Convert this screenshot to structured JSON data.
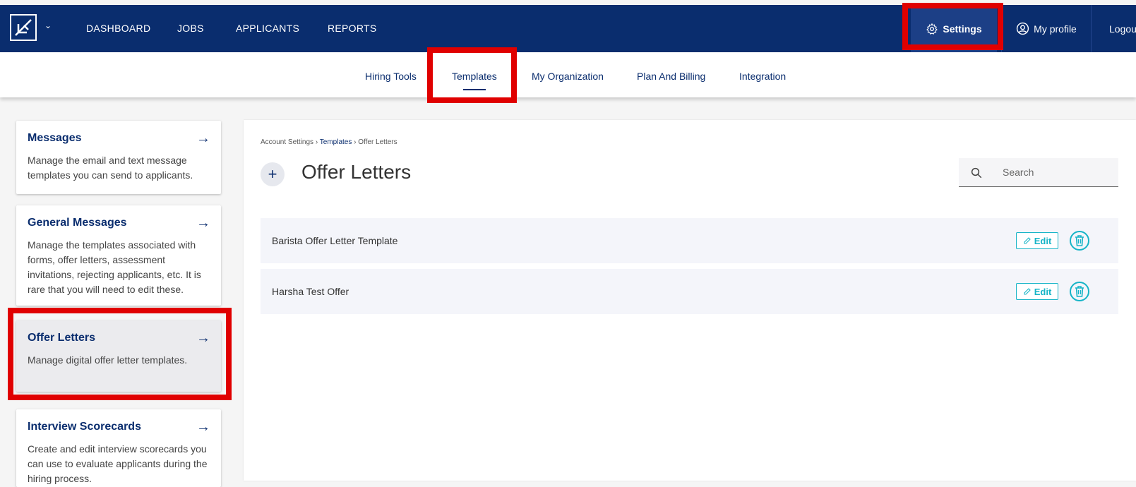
{
  "topnav": {
    "items": [
      "DASHBOARD",
      "JOBS",
      "APPLICANTS",
      "REPORTS"
    ],
    "settings": "Settings",
    "profile": "My profile",
    "logout": "Logout"
  },
  "subnav": {
    "tabs": [
      "Hiring Tools",
      "Templates",
      "My Organization",
      "Plan And Billing",
      "Integration"
    ],
    "active": "Templates"
  },
  "sidebar": {
    "cards": [
      {
        "title": "Messages",
        "description": "Manage the email and text message templates you can send to applicants."
      },
      {
        "title": "General Messages",
        "description": "Manage the templates associated with forms, offer letters, assessment invitations, rejecting applicants, etc. It is rare that you will need to edit these."
      },
      {
        "title": "Offer Letters",
        "description": "Manage digital offer letter templates."
      },
      {
        "title": "Interview Scorecards",
        "description": "Create and edit interview scorecards you can use to evaluate applicants during the hiring process."
      }
    ]
  },
  "main": {
    "breadcrumb": [
      "Account Settings",
      "Templates",
      "Offer Letters"
    ],
    "title": "Offer Letters",
    "search_placeholder": "Search",
    "rows": [
      {
        "name": "Barista Offer Letter Template",
        "edit": "Edit"
      },
      {
        "name": "Harsha Test Offer",
        "edit": "Edit"
      }
    ]
  },
  "colors": {
    "navy": "#0a2d6e",
    "teal": "#17b4c7",
    "highlight": "#e00000"
  }
}
